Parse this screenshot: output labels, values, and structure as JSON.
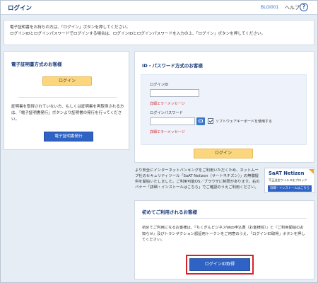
{
  "header": {
    "title": "ログイン",
    "screen_code": "BLGI001",
    "help_label": "ヘルプ",
    "help_icon": "?"
  },
  "notice": {
    "line1": "電子証明書をお持ちの方は、「ログイン」ボタンを押してください。",
    "line2": "ログインIDとログインパスワードでログインする場合は、ログインIDとログインパスワードを入力の上、「ログイン」ボタンを押してください。"
  },
  "certificate_panel": {
    "title": "電子証明書方式のお客様",
    "login_button": "ログイン",
    "note": "証明書を取得されていない方、もしくは証明書を再取得される方は、「電子証明書発行」ボタンより証明書の発行を行ってください。",
    "issue_button": "電子証明書発行"
  },
  "id_panel": {
    "title": "ID・パスワード方式のお客様",
    "id_label": "ログインID",
    "id_value": "",
    "id_error": "詳細エラーメッセージ",
    "password_label": "ログインパスワード",
    "password_value": "",
    "password_error": "詳細エラーメッセージ",
    "software_keyboard_label": "ソフトウェアキーボードを使用する",
    "software_keyboard_checked": true,
    "login_button": "ログイン"
  },
  "security": {
    "note": "より安全にインターネットバンキングをご利用いただくため、ネットムーブ社のセキュリティツール「SaAT Netizen（サートネチズン）」の無償提供を開始いたしました。ご利用可能OS／ブラウザに制限があります。右のバナー「詳細・インストールはこちら」でご確認のうえご利用ください。",
    "banner_brand": "SaAT Netizen",
    "banner_sub": "不正送金ウイルスをブロック",
    "banner_button": "詳細・インストールはこちら"
  },
  "first_time": {
    "title": "初めてご利用されるお客様",
    "note": "初めてご利用になるお客様は、『ちくぎんビジネスWeb申込書（お客様控）』と『ご利用開始のお知らせ』及びトランザクション認証用トークンをご用意のうえ、「ログインID取得」ボタンを押してください。",
    "button": "ログインID取得"
  },
  "colors": {
    "accent": "#2e62c4",
    "login_button": "#fcd67c",
    "error": "#d23030",
    "highlight": "#d8202a"
  }
}
